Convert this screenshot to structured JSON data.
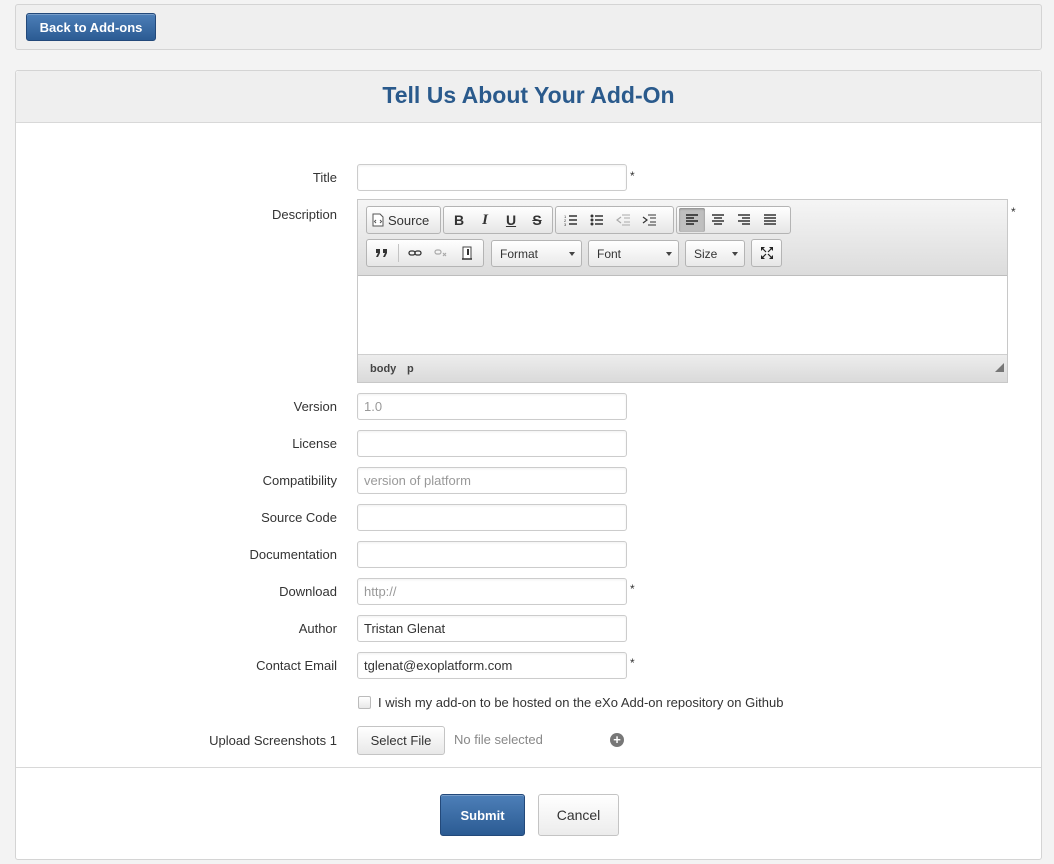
{
  "topbar": {
    "back_label": "Back to Add-ons"
  },
  "form": {
    "heading": "Tell Us About Your Add-On",
    "required_marker": "*",
    "fields": {
      "title": {
        "label": "Title",
        "value": "",
        "placeholder": ""
      },
      "description": {
        "label": "Description"
      },
      "version": {
        "label": "Version",
        "value": "",
        "placeholder": "1.0"
      },
      "license": {
        "label": "License",
        "value": "",
        "placeholder": ""
      },
      "compatibility": {
        "label": "Compatibility",
        "value": "",
        "placeholder": "version of platform"
      },
      "source_code": {
        "label": "Source Code",
        "value": "",
        "placeholder": ""
      },
      "documentation": {
        "label": "Documentation",
        "value": "",
        "placeholder": ""
      },
      "download": {
        "label": "Download",
        "value": "",
        "placeholder": "http://"
      },
      "author": {
        "label": "Author",
        "value": "Tristan Glenat",
        "placeholder": ""
      },
      "contact_email": {
        "label": "Contact Email",
        "value": "tglenat@exoplatform.com",
        "placeholder": ""
      }
    },
    "hosted_checkbox": {
      "label": "I wish my add-on to be hosted on the eXo Add-on repository on Github",
      "checked": false
    },
    "upload": {
      "label": "Upload Screenshots 1",
      "button_label": "Select File",
      "status": "No file selected"
    },
    "submit_label": "Submit",
    "cancel_label": "Cancel"
  },
  "editor": {
    "source_label": "Source",
    "bold": "B",
    "italic": "I",
    "underline": "U",
    "strike": "S",
    "format_label": "Format",
    "font_label": "Font",
    "size_label": "Size",
    "path": [
      "body",
      "p"
    ]
  },
  "icons": [
    "source-icon",
    "numbered-list-icon",
    "bullet-list-icon",
    "outdent-icon",
    "indent-icon",
    "align-left-icon",
    "align-center-icon",
    "align-right-icon",
    "justify-icon",
    "blockquote-icon",
    "link-icon",
    "unlink-icon",
    "anchor-icon",
    "maximize-icon",
    "add-icon",
    "resize-grip-icon"
  ],
  "colors": {
    "accent": "#2a5a8c",
    "button_primary": "#3468a4"
  }
}
